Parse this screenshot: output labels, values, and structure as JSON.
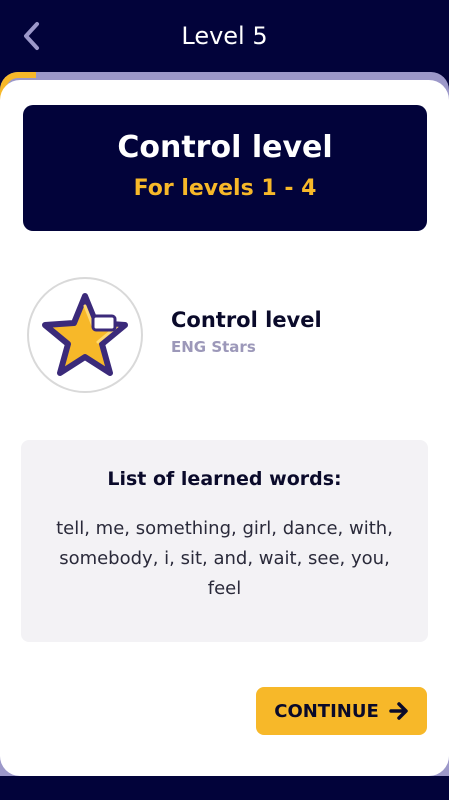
{
  "header": {
    "title": "Level 5",
    "back_icon": "chevron-left-icon"
  },
  "hero": {
    "title": "Control level",
    "subtitle": "For levels 1 - 4"
  },
  "course": {
    "name": "Control level",
    "subtitle": "ENG Stars",
    "avatar_icon": "star-icon"
  },
  "words": {
    "title": "List of learned words:",
    "list": "tell, me, something, girl, dance, with, somebody, i, sit, and, wait, see, you, feel"
  },
  "actions": {
    "continue_label": "CONTINUE",
    "continue_icon": "arrow-right-icon"
  },
  "colors": {
    "background": "#02033a",
    "accent": "#f7b829",
    "card_back": "#9c98c9"
  }
}
